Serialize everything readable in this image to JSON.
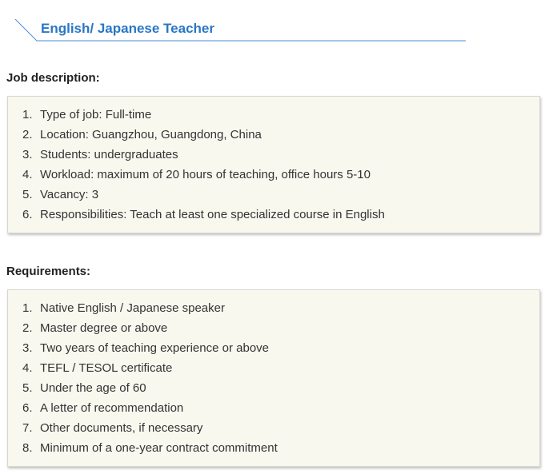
{
  "header": {
    "title": "English/ Japanese Teacher"
  },
  "job_description": {
    "heading": "Job description:",
    "items": [
      {
        "num": "1.",
        "text": "Type of job: Full-time"
      },
      {
        "num": "2.",
        "text": "Location: Guangzhou, Guangdong, China"
      },
      {
        "num": "3.",
        "text": "Students: undergraduates"
      },
      {
        "num": "4.",
        "text": "Workload: maximum of 20 hours of teaching, office hours 5-10"
      },
      {
        "num": "5.",
        "text": "Vacancy: 3"
      },
      {
        "num": "6.",
        "text": "Responsibilities: Teach at least one specialized course in English"
      }
    ]
  },
  "requirements": {
    "heading": "Requirements:",
    "items": [
      {
        "num": "1.",
        "text": "Native English / Japanese speaker"
      },
      {
        "num": "2.",
        "text": "Master degree or above"
      },
      {
        "num": "3.",
        "text": "Two years of teaching experience or above"
      },
      {
        "num": "4.",
        "text": "TEFL / TESOL certificate"
      },
      {
        "num": "5.",
        "text": "Under the age of 60"
      },
      {
        "num": "6.",
        "text": "A letter of recommendation"
      },
      {
        "num": "7.",
        "text": "Other documents, if necessary"
      },
      {
        "num": "8.",
        "text": "Minimum of a one-year contract commitment"
      }
    ]
  },
  "colors": {
    "title": "#2a76c4",
    "title_rule": "#4a8fd6",
    "box_background": "#f8f8ef"
  }
}
